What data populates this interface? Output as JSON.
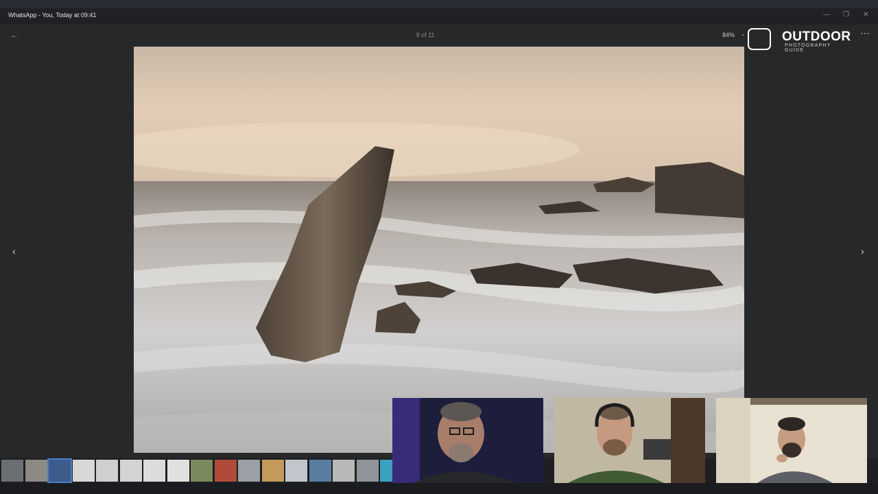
{
  "window": {
    "title": "WhatsApp - You, Today at 09:41",
    "minimize_icon": "minimize-icon",
    "restore_icon": "restore-icon",
    "close_icon": "close-icon"
  },
  "viewer": {
    "back_icon": "back-arrow-icon",
    "counter": "9 of 11",
    "zoom": "84%",
    "zoom_menu_icon": "chevron-down-icon",
    "more_icon": "more-options-icon",
    "prev_icon": "chevron-left-icon",
    "next_icon": "chevron-right-icon"
  },
  "brand": {
    "name": "OUTDOOR",
    "subtitle": "PHOTOGRAPHY GUIDE"
  },
  "thumbnail_count": 17,
  "selected_thumbnail": 3,
  "participants": [
    {
      "name": "participant-1"
    },
    {
      "name": "participant-2"
    },
    {
      "name": "participant-3"
    }
  ],
  "colors": {
    "viewer_bg": "#272829",
    "titlebar_bg": "#202124",
    "accent": "#4a7fd0"
  }
}
